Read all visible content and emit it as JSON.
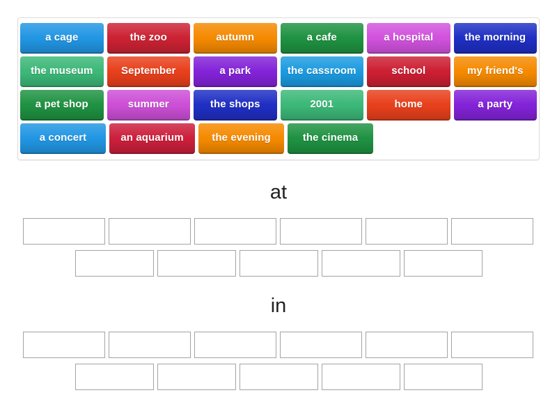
{
  "activity": {
    "type": "group-sort",
    "tile_text_color": "#ffffff"
  },
  "tile_bank": {
    "name": "word-tile-bank",
    "rows": [
      [
        {
          "label": "a cage",
          "color": "#2196e3"
        },
        {
          "label": "the zoo",
          "color": "#cc2233"
        },
        {
          "label": "autumn",
          "color": "#f58a00"
        },
        {
          "label": "a cafe",
          "color": "#1f9242"
        },
        {
          "label": "a hospital",
          "color": "#d152dd"
        },
        {
          "label": "the morning",
          "color": "#1f2fc4"
        }
      ],
      [
        {
          "label": "the museum",
          "color": "#3cb878"
        },
        {
          "label": "September",
          "color": "#e8401c"
        },
        {
          "label": "a park",
          "color": "#8323d8"
        },
        {
          "label": "the cassroom",
          "color": "#1b9be0"
        },
        {
          "label": "school",
          "color": "#cc1f33"
        },
        {
          "label": "my friend's",
          "color": "#f58a00"
        }
      ],
      [
        {
          "label": "a pet shop",
          "color": "#1f9242"
        },
        {
          "label": "summer",
          "color": "#cc4fd6"
        },
        {
          "label": "the shops",
          "color": "#1f2fc4"
        },
        {
          "label": "2001",
          "color": "#3cb878"
        },
        {
          "label": "home",
          "color": "#e8401c"
        },
        {
          "label": "a party",
          "color": "#8323d8"
        }
      ],
      [
        {
          "label": "a concert",
          "color": "#2196e3"
        },
        {
          "label": "an aquarium",
          "color": "#cc1f3c"
        },
        {
          "label": "the evening",
          "color": "#f58a00"
        },
        {
          "label": "the cinema",
          "color": "#1f9242"
        }
      ]
    ]
  },
  "groups": [
    {
      "title": "at",
      "slot_rows": [
        [
          "",
          "",
          "",
          "",
          "",
          ""
        ],
        [
          "",
          "",
          "",
          "",
          ""
        ]
      ]
    },
    {
      "title": "in",
      "slot_rows": [
        [
          "",
          "",
          "",
          "",
          "",
          ""
        ],
        [
          "",
          "",
          "",
          "",
          ""
        ]
      ]
    }
  ]
}
